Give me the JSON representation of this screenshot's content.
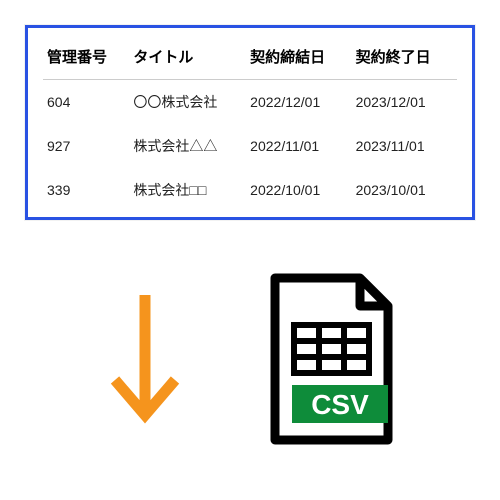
{
  "table": {
    "headers": {
      "col1": "管理番号",
      "col2": "タイトル",
      "col3": "契約締結日",
      "col4": "契約終了日"
    },
    "rows": [
      {
        "id": "604",
        "title": "〇〇株式会社",
        "start": "2022/12/01",
        "end": "2023/12/01"
      },
      {
        "id": "927",
        "title": "株式会社△△",
        "start": "2022/11/01",
        "end": "2023/11/01"
      },
      {
        "id": "339",
        "title": "株式会社□□",
        "start": "2022/10/01",
        "end": "2023/10/01"
      }
    ]
  },
  "csv": {
    "label": "CSV"
  },
  "colors": {
    "table_border": "#2952e3",
    "arrow": "#f5941d",
    "csv_label_bg": "#0e8c3a",
    "file_stroke": "#000"
  }
}
